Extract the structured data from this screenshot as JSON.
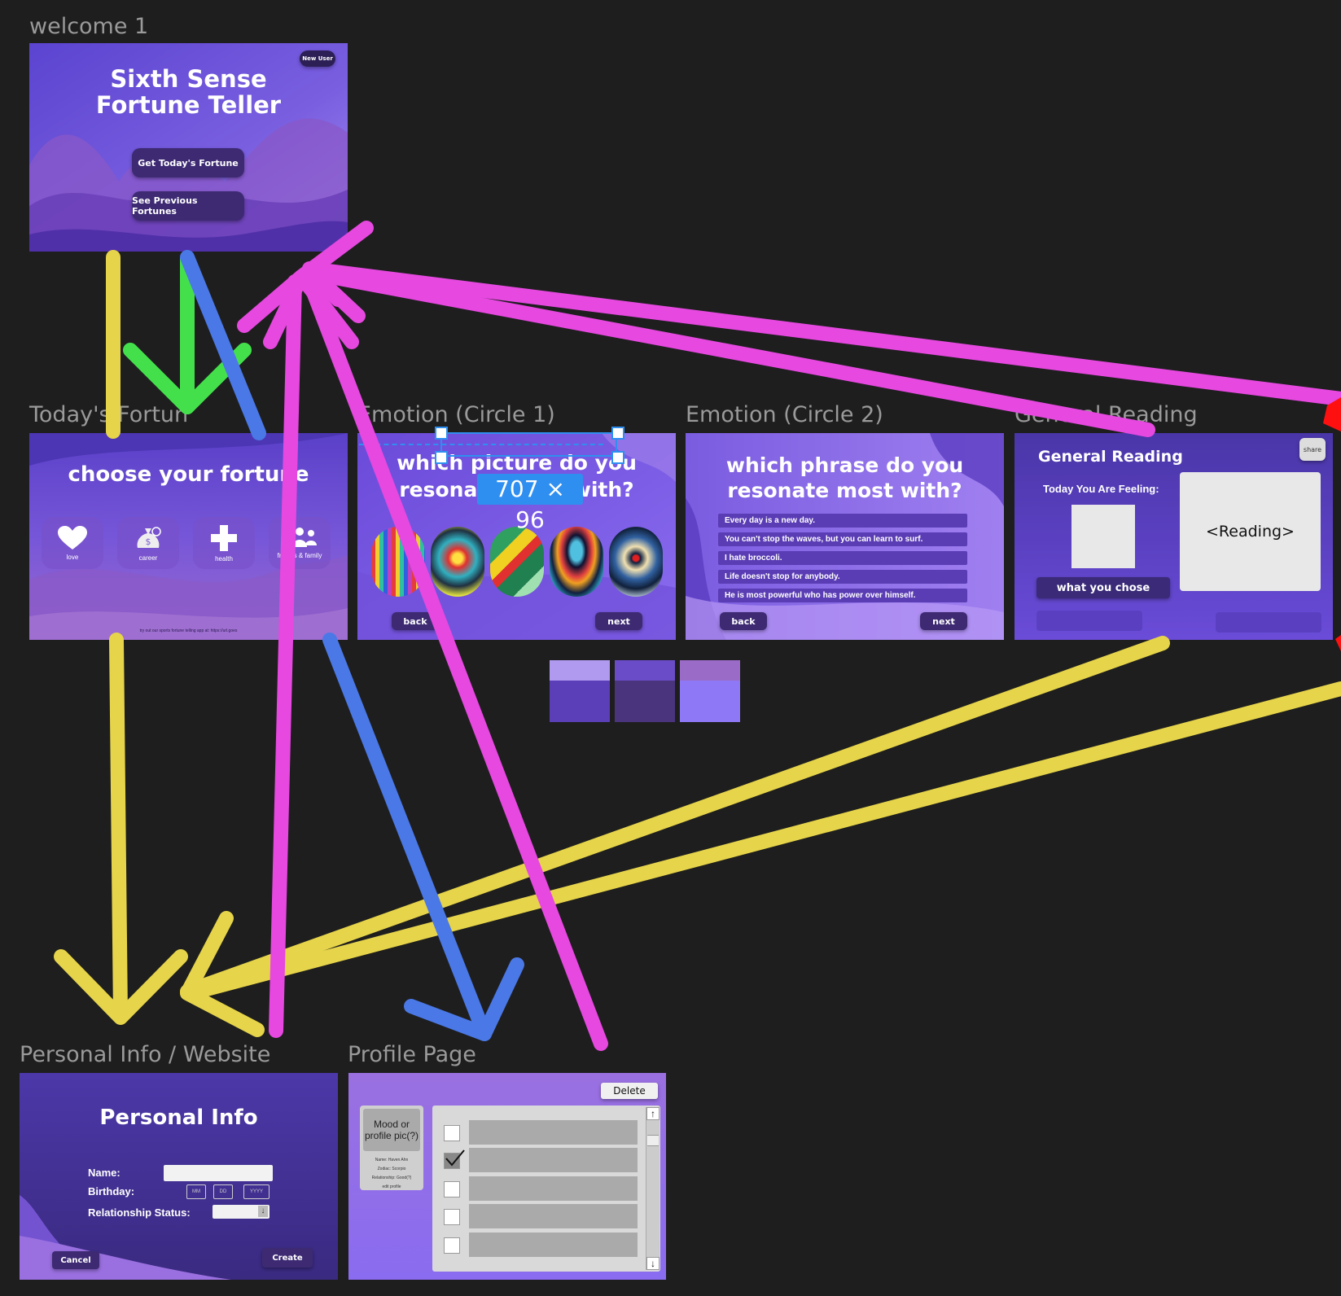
{
  "frames": {
    "welcome": {
      "label": "welcome 1",
      "badge": "New User",
      "title_line1": "Sixth  Sense",
      "title_line2": "Fortune  Teller",
      "btn_today": "Get Today's Fortune",
      "btn_previous": "See Previous Fortunes"
    },
    "todays": {
      "label": "Today's Fortun",
      "title": "choose your fortune",
      "categories": [
        {
          "label": "love",
          "icon": "heart-icon"
        },
        {
          "label": "career",
          "icon": "money-bag-icon"
        },
        {
          "label": "health",
          "icon": "plus-icon"
        },
        {
          "label": "friends & family",
          "icon": "people-icon"
        }
      ],
      "footer": "try out our sports fortune telling app at: https://url.goes"
    },
    "emotion1": {
      "label": "Emotion (Circle 1)",
      "title_line1": "which picture do you",
      "title_line2": "resonate most with?",
      "back": "back",
      "next": "next"
    },
    "emotion2": {
      "label": "Emotion (Circle 2)",
      "title_line1": "which phrase do you",
      "title_line2": "resonate most with?",
      "phrases": [
        "Every day is a new day.",
        "You can't stop the waves, but you can learn to surf.",
        "I hate broccoli.",
        "Life doesn't stop for anybody.",
        "He is most powerful who has power over himself."
      ],
      "back": "back",
      "next": "next"
    },
    "general": {
      "label": "General Reading",
      "title": "General Reading",
      "share": "share",
      "feeling": "Today You Are Feeling:",
      "reading": "<Reading>",
      "chose": "what you chose"
    },
    "personal": {
      "label": "Personal Info / Website",
      "title": "Personal Info",
      "name_label": "Name:",
      "birthday_label": "Birthday:",
      "relationship_label": "Relationship Status:",
      "mm": "MM",
      "dd": "DD",
      "yyyy": "YYYY",
      "dropdown_arrow": "↓",
      "cancel": "Cancel",
      "create": "Create"
    },
    "profile": {
      "label": "Profile Page",
      "delete": "Delete",
      "avatar_text": "Mood or profile pic(?)",
      "details": [
        "Name: Haven Ahn",
        "Zodiac: Scorpio",
        "Relationship: Good(?)"
      ],
      "edit": "edit profile",
      "scroll_up": "↑",
      "scroll_down": "↓",
      "rows": [
        {
          "checked": false
        },
        {
          "checked": true
        },
        {
          "checked": false
        },
        {
          "checked": false
        },
        {
          "checked": false
        }
      ]
    }
  },
  "selection": {
    "size_label": "707 × 96"
  },
  "swatches": {
    "top": [
      "#b09af0",
      "#6a4cc8",
      "#9a6cc8"
    ],
    "bottom": [
      "#5b3fb8",
      "#4a347e",
      "#8e78f5"
    ]
  },
  "colors": {
    "canvas": "#1e1e1e",
    "frame_purple": "#6a4cd0",
    "button_dark": "#3d2a73",
    "arrow_pink": "#e648e0",
    "arrow_yellow": "#e6d44a",
    "arrow_blue": "#4a78e6",
    "arrow_green": "#44e04c",
    "selection_blue": "#2f8ff0"
  }
}
